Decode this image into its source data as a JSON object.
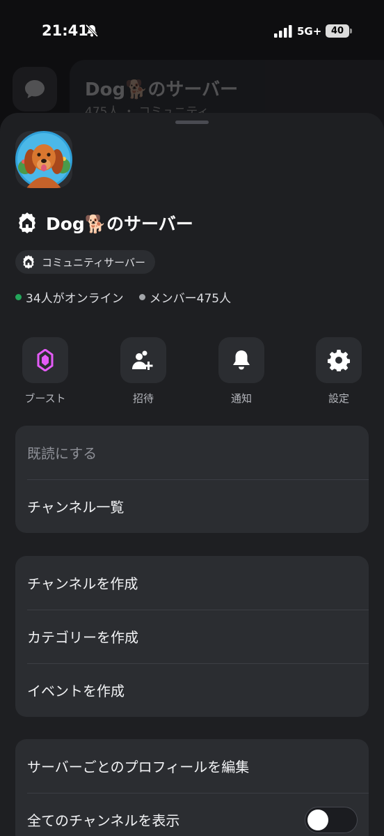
{
  "status_bar": {
    "time": "21:41",
    "network": "5G+",
    "battery": "40",
    "icons": [
      "bell-off-icon",
      "signal-icon",
      "battery-icon"
    ]
  },
  "background": {
    "server_title": "Dog🐕のサーバー",
    "server_sub": "475人 ・ コミュニティ"
  },
  "server": {
    "name": "Dog🐕のサーバー",
    "badge": "コミュニティサーバー",
    "online": "34人がオンライン",
    "members": "メンバー475人",
    "colors": {
      "online": "#23a55a",
      "boost": "#e45bf7",
      "sheet": "#1e1f22",
      "card": "#2b2d31"
    }
  },
  "actions": [
    {
      "label": "ブースト",
      "icon": "boost-gem-icon"
    },
    {
      "label": "招待",
      "icon": "add-friend-icon"
    },
    {
      "label": "通知",
      "icon": "bell-icon"
    },
    {
      "label": "設定",
      "icon": "gear-icon"
    }
  ],
  "menu_group_1": [
    "既読にする",
    "チャンネル一覧"
  ],
  "menu_group_2": [
    "チャンネルを作成",
    "カテゴリーを作成",
    "イベントを作成"
  ],
  "menu_group_3": {
    "edit_profile": "サーバーごとのプロフィールを編集",
    "show_all_channels": "全てのチャンネルを表示",
    "show_all_channels_on": false
  }
}
